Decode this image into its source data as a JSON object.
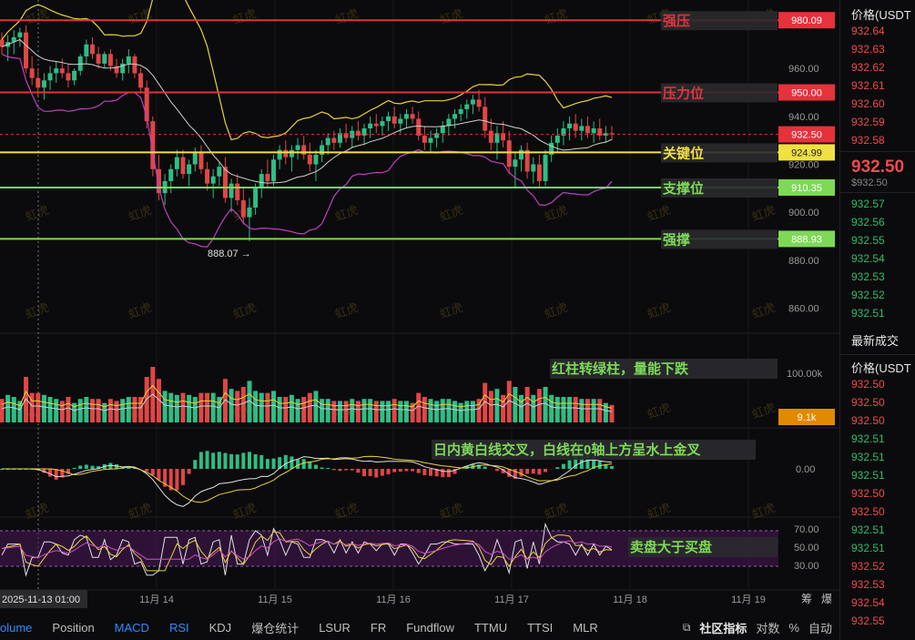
{
  "chart_data": {
    "type": "candlestick",
    "symbol_axis_label": "价格(USDT)",
    "x_ticks": [
      "2025-11-13 01:00",
      "11月 14",
      "11月 15",
      "11月 16",
      "11月 17",
      "11月 18",
      "11月 19"
    ],
    "price_axis": {
      "ticks": [
        960.0,
        940.0,
        920.0,
        900.0,
        880.0,
        860.0
      ],
      "range": [
        850,
        987
      ]
    },
    "levels": [
      {
        "name": "强压",
        "value": 980.09,
        "label": "980.09",
        "color": "#e5323b"
      },
      {
        "name": "压力位",
        "value": 950.0,
        "label": "950.00",
        "color": "#e5323b"
      },
      {
        "name": "关键位",
        "value": 924.99,
        "label": "924.99",
        "color": "#f0e040"
      },
      {
        "name": "支撑位",
        "value": 910.35,
        "label": "910.35",
        "color": "#7ed957"
      },
      {
        "name": "强撑",
        "value": 888.93,
        "label": "888.93",
        "color": "#7ed957"
      }
    ],
    "last_price": {
      "value": 932.5,
      "label": "932.50",
      "color": "#e5323b"
    },
    "low_marker": "888.07 →",
    "watermark": "虹虎",
    "candles_ohlc": [
      [
        972,
        975,
        966,
        969
      ],
      [
        969,
        974,
        963,
        971
      ],
      [
        971,
        976,
        966,
        973
      ],
      [
        973,
        977,
        969,
        975
      ],
      [
        975,
        978,
        958,
        960
      ],
      [
        960,
        965,
        953,
        956
      ],
      [
        956,
        960,
        948,
        952
      ],
      [
        952,
        958,
        947,
        955
      ],
      [
        955,
        961,
        951,
        958
      ],
      [
        958,
        963,
        954,
        960
      ],
      [
        960,
        964,
        956,
        958
      ],
      [
        958,
        962,
        952,
        955
      ],
      [
        955,
        960,
        953,
        959
      ],
      [
        959,
        966,
        957,
        965
      ],
      [
        965,
        972,
        962,
        970
      ],
      [
        970,
        973,
        964,
        966
      ],
      [
        966,
        969,
        960,
        962
      ],
      [
        962,
        967,
        960,
        966
      ],
      [
        966,
        968,
        959,
        961
      ],
      [
        961,
        964,
        956,
        958
      ],
      [
        958,
        964,
        955,
        962
      ],
      [
        962,
        968,
        958,
        965
      ],
      [
        965,
        966,
        956,
        958
      ],
      [
        958,
        960,
        950,
        952
      ],
      [
        952,
        955,
        935,
        938
      ],
      [
        938,
        940,
        915,
        918
      ],
      [
        918,
        924,
        905,
        908
      ],
      [
        908,
        916,
        903,
        913
      ],
      [
        913,
        920,
        908,
        918
      ],
      [
        918,
        926,
        915,
        923
      ],
      [
        923,
        926,
        914,
        916
      ],
      [
        916,
        922,
        911,
        920
      ],
      [
        920,
        927,
        917,
        925
      ],
      [
        925,
        928,
        916,
        918
      ],
      [
        918,
        921,
        909,
        912
      ],
      [
        912,
        918,
        906,
        915
      ],
      [
        915,
        921,
        911,
        919
      ],
      [
        919,
        923,
        904,
        906
      ],
      [
        906,
        914,
        900,
        912
      ],
      [
        912,
        916,
        903,
        905
      ],
      [
        905,
        910,
        895,
        898
      ],
      [
        898,
        906,
        888,
        902
      ],
      [
        902,
        912,
        899,
        910
      ],
      [
        910,
        918,
        906,
        916
      ],
      [
        916,
        922,
        910,
        913
      ],
      [
        913,
        924,
        911,
        922
      ],
      [
        922,
        928,
        918,
        926
      ],
      [
        926,
        930,
        920,
        923
      ],
      [
        923,
        928,
        917,
        926
      ],
      [
        926,
        931,
        922,
        928
      ],
      [
        928,
        932,
        922,
        924
      ],
      [
        924,
        929,
        917,
        920
      ],
      [
        920,
        926,
        913,
        924
      ],
      [
        924,
        930,
        921,
        928
      ],
      [
        928,
        933,
        924,
        931
      ],
      [
        931,
        934,
        926,
        929
      ],
      [
        929,
        935,
        927,
        933
      ],
      [
        933,
        937,
        929,
        931
      ],
      [
        931,
        936,
        927,
        934
      ],
      [
        934,
        938,
        930,
        932
      ],
      [
        932,
        937,
        928,
        935
      ],
      [
        935,
        940,
        931,
        937
      ],
      [
        937,
        941,
        933,
        936
      ],
      [
        936,
        940,
        932,
        938
      ],
      [
        938,
        942,
        934,
        940
      ],
      [
        940,
        944,
        935,
        937
      ],
      [
        937,
        941,
        933,
        939
      ],
      [
        939,
        943,
        935,
        941
      ],
      [
        941,
        944,
        937,
        939
      ],
      [
        939,
        942,
        930,
        932
      ],
      [
        932,
        936,
        926,
        929
      ],
      [
        929,
        934,
        925,
        931
      ],
      [
        931,
        935,
        927,
        933
      ],
      [
        933,
        938,
        929,
        936
      ],
      [
        936,
        941,
        932,
        939
      ],
      [
        939,
        943,
        935,
        941
      ],
      [
        941,
        945,
        938,
        943
      ],
      [
        943,
        947,
        939,
        945
      ],
      [
        945,
        949,
        941,
        947
      ],
      [
        947,
        951,
        942,
        944
      ],
      [
        944,
        948,
        931,
        934
      ],
      [
        934,
        939,
        926,
        929
      ],
      [
        929,
        936,
        922,
        933
      ],
      [
        933,
        938,
        927,
        930
      ],
      [
        930,
        934,
        916,
        919
      ],
      [
        919,
        925,
        910,
        922
      ],
      [
        922,
        928,
        917,
        926
      ],
      [
        926,
        929,
        914,
        917
      ],
      [
        917,
        923,
        912,
        920
      ],
      [
        920,
        924,
        910,
        913
      ],
      [
        913,
        926,
        911,
        924
      ],
      [
        924,
        932,
        921,
        929
      ],
      [
        929,
        935,
        925,
        932
      ],
      [
        932,
        938,
        928,
        935
      ],
      [
        935,
        940,
        930,
        937
      ],
      [
        937,
        941,
        931,
        934
      ],
      [
        934,
        939,
        930,
        936
      ],
      [
        936,
        940,
        931,
        933
      ],
      [
        933,
        938,
        929,
        935
      ],
      [
        935,
        939,
        930,
        932
      ],
      [
        932,
        936,
        929,
        933
      ],
      [
        933,
        936,
        930,
        932.5
      ]
    ],
    "volume_axis": {
      "ticks": [
        "100.00k"
      ],
      "current": "9.1k"
    },
    "macd_axis": {
      "ticks": [
        "0.00"
      ]
    },
    "rsi_axis": {
      "ticks": [
        "70.00",
        "50.00",
        "30.00"
      ],
      "band": [
        30,
        70
      ]
    },
    "annotations": [
      {
        "text": "红柱转绿柱，量能下跌"
      },
      {
        "text": "日内黄白线交叉，白线在0轴上方呈水上金叉"
      },
      {
        "text": "卖盘大于买盘"
      }
    ]
  },
  "tabs": {
    "items": [
      "olume",
      "Position",
      "MACD",
      "RSI",
      "KDJ",
      "爆仓统计",
      "LSUR",
      "FR",
      "Fundflow",
      "TTMU",
      "TTSI",
      "MLR"
    ],
    "community": "社区指标",
    "log_label": "对数",
    "pct_label": "%",
    "auto_label": "自动",
    "tool1": "筹",
    "tool2": "爆"
  },
  "sidebar": {
    "title": "价格(USDT",
    "asks": [
      "932.64",
      "932.63",
      "932.62",
      "932.61",
      "932.60",
      "932.59",
      "932.58"
    ],
    "current_big": "932.50",
    "current_small": "$932.50",
    "bids": [
      "932.57",
      "932.56",
      "932.55",
      "932.54",
      "932.53",
      "932.52",
      "932.51"
    ],
    "trades_title": "最新成交",
    "trades_header": "价格(USDT",
    "trades": [
      {
        "p": "932.50",
        "c": "red"
      },
      {
        "p": "932.50",
        "c": "red"
      },
      {
        "p": "932.50",
        "c": "red"
      },
      {
        "p": "932.51",
        "c": "green"
      },
      {
        "p": "932.51",
        "c": "green"
      },
      {
        "p": "932.51",
        "c": "green"
      },
      {
        "p": "932.50",
        "c": "red"
      },
      {
        "p": "932.50",
        "c": "red"
      },
      {
        "p": "932.51",
        "c": "green"
      },
      {
        "p": "932.51",
        "c": "green"
      },
      {
        "p": "932.52",
        "c": "red"
      },
      {
        "p": "932.53",
        "c": "red"
      },
      {
        "p": "932.54",
        "c": "red"
      },
      {
        "p": "932.55",
        "c": "red"
      }
    ]
  }
}
